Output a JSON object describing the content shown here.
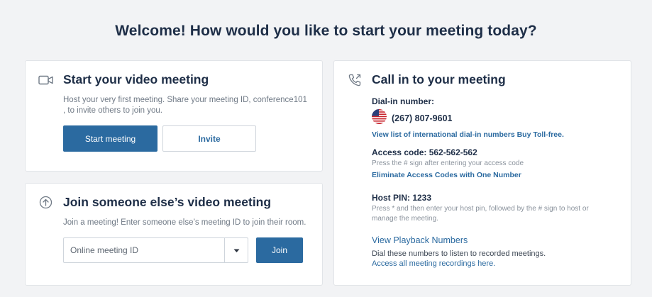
{
  "page": {
    "title": "Welcome! How would you like to start your meeting today?"
  },
  "start_card": {
    "title": "Start your video meeting",
    "description": "Host your very first meeting. Share your meeting ID, conference101 , to invite others to join you.",
    "start_label": "Start meeting",
    "invite_label": "Invite",
    "icon": "video-camera-icon"
  },
  "join_card": {
    "title": "Join someone else’s video meeting",
    "description": "Join a meeting! Enter someone else’s meeting ID to join their room.",
    "input_placeholder": "Online meeting ID",
    "input_value": "",
    "join_label": "Join",
    "icon": "arrow-up-circle-icon"
  },
  "call_card": {
    "title": "Call in to your meeting",
    "icon": "phone-outgoing-icon",
    "dial_in": {
      "label": "Dial-in number:",
      "flag": "us-flag-icon",
      "number": "(267) 807-9601",
      "link": "View list of international dial-in numbers Buy Toll-free."
    },
    "access": {
      "label": "Access code: 562-562-562",
      "note": "Press the # sign after entering your access code",
      "link": "Eliminate Access Codes with One Number"
    },
    "host_pin": {
      "label": "Host PIN: 1233",
      "note": "Press * and then enter your host pin, followed by the # sign to host or manage the meeting."
    },
    "playback": {
      "link": "View Playback Numbers",
      "text": "Dial these numbers to listen to recorded meetings.",
      "recordings_link": "Access all meeting recordings here."
    }
  },
  "colors": {
    "primary": "#2b6aa0",
    "heading": "#1e2e47",
    "background": "#f2f3f5",
    "border": "#e1e4e8"
  }
}
